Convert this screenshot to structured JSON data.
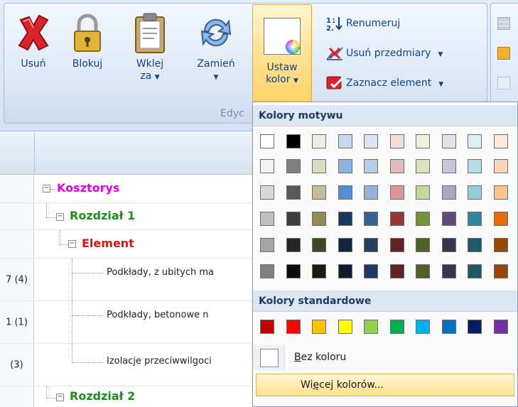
{
  "ribbon": {
    "buttons": [
      {
        "label": "Usuń",
        "icon": "delete-x-icon"
      },
      {
        "label": "Blokuj",
        "icon": "padlock-icon"
      },
      {
        "label": "Wklej",
        "sub": "za",
        "icon": "clipboard-icon"
      },
      {
        "label": "Zamień",
        "icon": "swap-arrows-icon"
      },
      {
        "label": "Ustaw",
        "sub": "kolor",
        "icon": "color-swatch-icon"
      }
    ],
    "small_buttons": [
      {
        "label": "Renumeruj",
        "icon": "renumber-icon"
      },
      {
        "label": "Usuń przedmiary",
        "icon": "delete-measure-icon"
      },
      {
        "label": "Zaznacz element",
        "icon": "select-element-icon"
      }
    ],
    "group_title": "Edyc"
  },
  "tree": {
    "nodes": [
      {
        "label": "Kosztorys",
        "color": "#e400e4",
        "kind": "root"
      },
      {
        "label": "Rozdział 1",
        "color": "#1a8f1a",
        "kind": "chapter"
      },
      {
        "label": "Element",
        "color": "#e01010",
        "kind": "element"
      },
      {
        "num": "7 (4)",
        "label": "Podkłady, z ubitych ma",
        "kind": "leaf"
      },
      {
        "num": "1 (1)",
        "label": "Podkłady, betonowe n",
        "kind": "leaf"
      },
      {
        "num": "(3)",
        "label": "Izolacje przeciwwilgoci",
        "kind": "leaf"
      },
      {
        "label": "Rozdział 2",
        "color": "#1a8f1a",
        "kind": "chapter"
      }
    ]
  },
  "dropdown": {
    "theme_title": "Kolory motywu",
    "standard_title": "Kolory standardowe",
    "no_color": "Bez koloru",
    "more_colors": "Więcej kolorów...",
    "theme_colors": [
      [
        "#ffffff",
        "#000000",
        "#eeece1",
        "#c6d9f0",
        "#dbe5f1",
        "#f2dcdb",
        "#ebf1dd",
        "#e5e0ec",
        "#dbeef3",
        "#fdeada"
      ],
      [
        "#f2f2f2",
        "#7f7f7f",
        "#ddd9c3",
        "#8db3e2",
        "#b8cce4",
        "#e5b9b7",
        "#d7e3bc",
        "#ccc1d9",
        "#b7dde8",
        "#fbd5b5"
      ],
      [
        "#d8d8d8",
        "#595959",
        "#c4bd97",
        "#548dd4",
        "#95b3d7",
        "#d99694",
        "#c3d69b",
        "#b2a2c7",
        "#92cddc",
        "#fac08f"
      ],
      [
        "#bfbfbf",
        "#3f3f3f",
        "#938953",
        "#17365d",
        "#366092",
        "#953734",
        "#76923c",
        "#5f497a",
        "#31859b",
        "#e36c09"
      ],
      [
        "#a5a5a5",
        "#262626",
        "#494429",
        "#0f243e",
        "#244061",
        "#632423",
        "#4f6128",
        "#3f3151",
        "#205867",
        "#974806"
      ],
      [
        "#7f7f7f",
        "#0c0c0c",
        "#1d1b10",
        "#0f1c2e",
        "#1f3864",
        "#632423",
        "#4f6128",
        "#3f3151",
        "#205867",
        "#974806"
      ]
    ],
    "standard_colors": [
      "#c00000",
      "#ff0000",
      "#ffc000",
      "#ffff00",
      "#92d050",
      "#00b050",
      "#00b0f0",
      "#0070c0",
      "#002060",
      "#7030a0"
    ]
  }
}
